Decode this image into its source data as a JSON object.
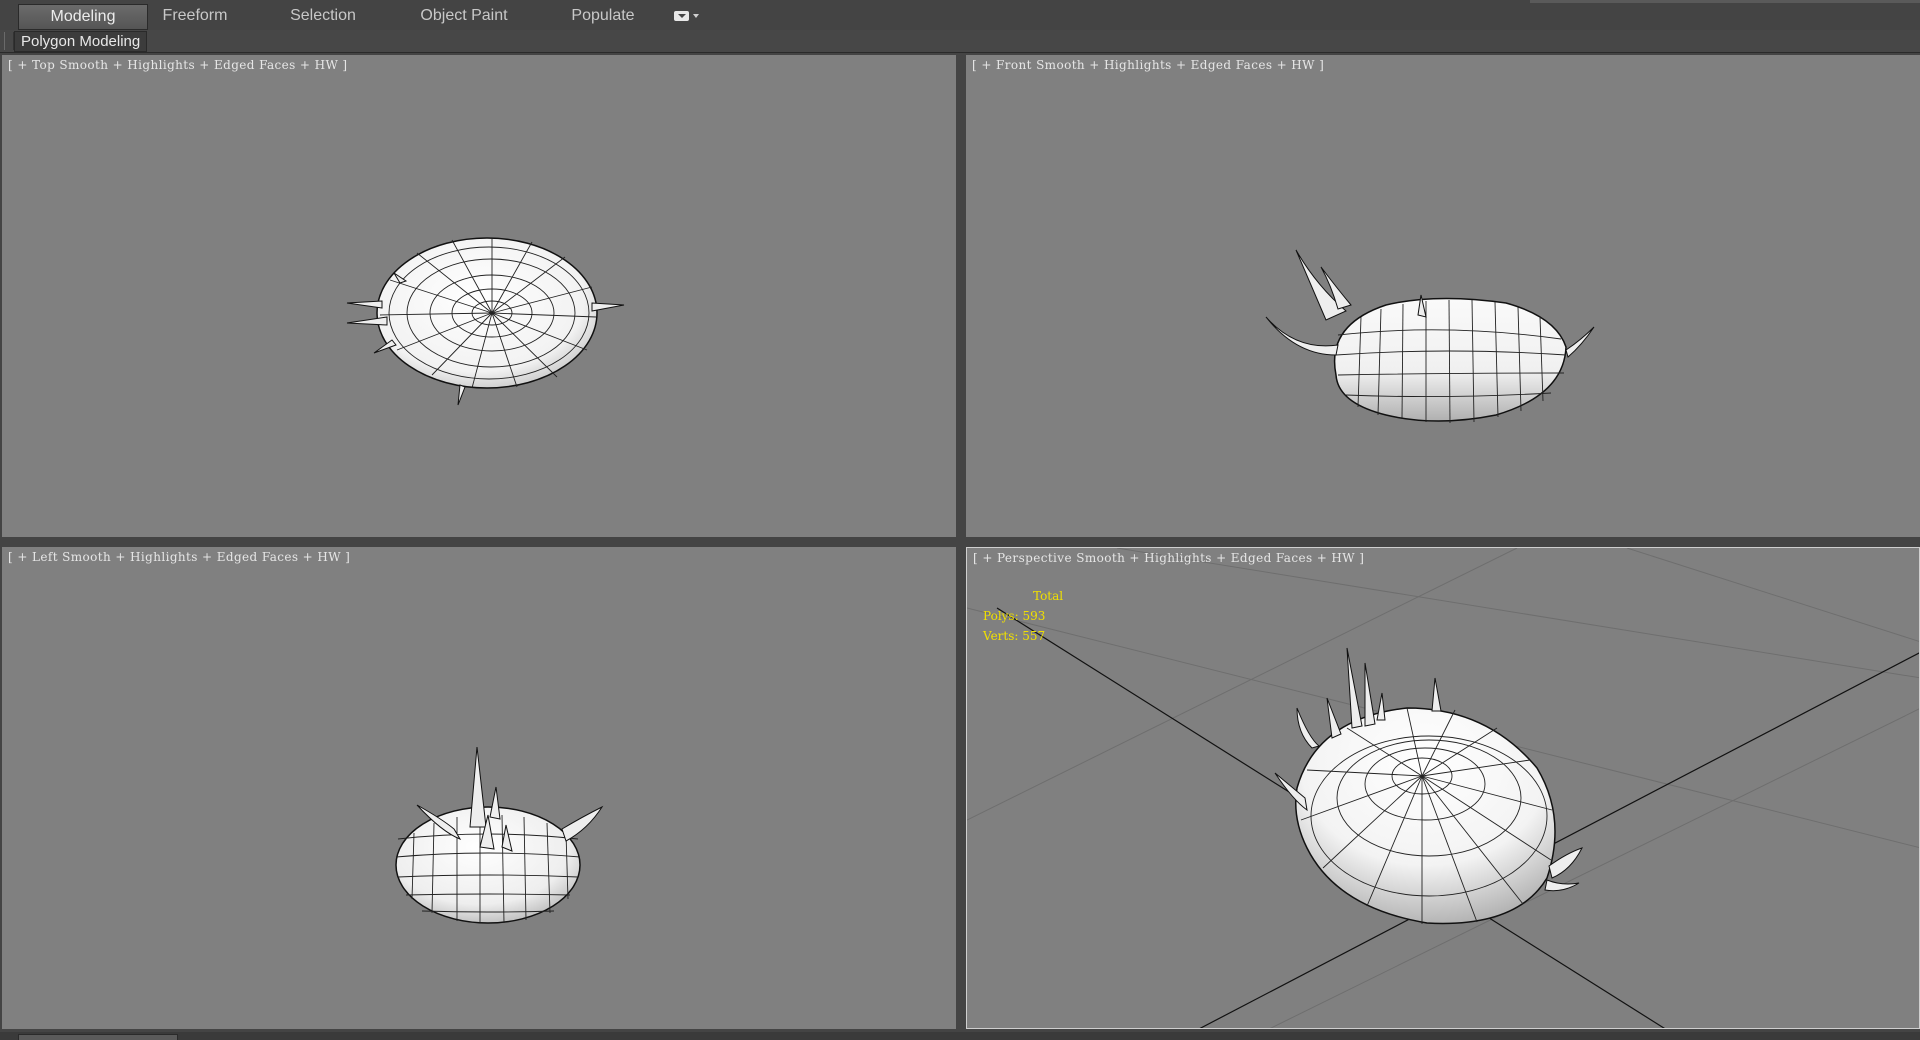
{
  "ribbon": {
    "tabs": [
      {
        "label": "Modeling",
        "active": true
      },
      {
        "label": "Freeform",
        "active": false
      },
      {
        "label": "Selection",
        "active": false
      },
      {
        "label": "Object Paint",
        "active": false
      },
      {
        "label": "Populate",
        "active": false
      }
    ],
    "extra_icon": "ribbon-options-icon"
  },
  "subribbon": {
    "tab_label": "Polygon Modeling"
  },
  "viewports": {
    "top": {
      "bracket_open": "[",
      "plus": "+",
      "name": "Top",
      "shading": "Smooth + Highlights + Edged Faces + HW",
      "bracket_close": "]"
    },
    "front": {
      "bracket_open": "[",
      "plus": "+",
      "name": "Front",
      "shading": "Smooth + Highlights + Edged Faces + HW",
      "bracket_close": "]"
    },
    "left": {
      "bracket_open": "[",
      "plus": "+",
      "name": "Left",
      "shading": "Smooth + Highlights + Edged Faces + HW",
      "bracket_close": "]"
    },
    "perspective": {
      "bracket_open": "[",
      "plus": "+",
      "name": "Perspective",
      "shading": "Smooth + Highlights + Edged Faces + HW",
      "bracket_close": "]",
      "stats": {
        "total_label": "Total",
        "polys_label": "Polys:",
        "polys_value": "593",
        "verts_label": "Verts:",
        "verts_value": "557"
      }
    }
  },
  "colors": {
    "viewport_bg": "#808080",
    "stats_text": "#f0e000",
    "ui_bg": "#444444",
    "active_border": "#cfcfcf"
  }
}
